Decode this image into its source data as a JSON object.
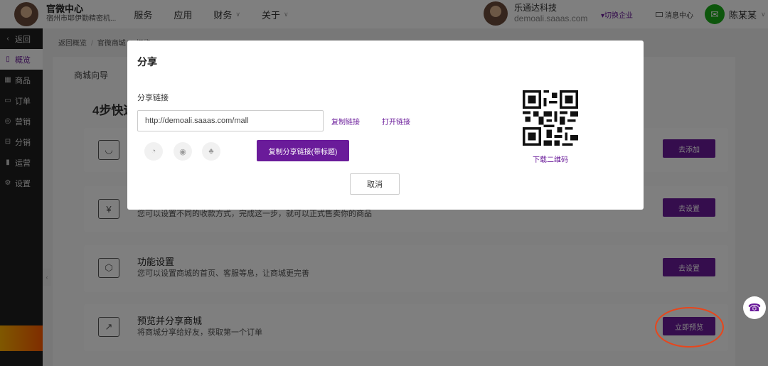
{
  "header": {
    "brand_title": "官微中心",
    "brand_subtitle": "宿州市耶伊勤精密机...",
    "nav": [
      {
        "label": "服务",
        "has_dropdown": false
      },
      {
        "label": "应用",
        "has_dropdown": false
      },
      {
        "label": "财务",
        "has_dropdown": true
      },
      {
        "label": "关于",
        "has_dropdown": true
      }
    ],
    "company_name": "乐通达科技",
    "company_domain": "demoali.saaas.com",
    "switch_company": "▾切换企业",
    "message_center": "消息中心",
    "user_name": "陈某某"
  },
  "sidebar": {
    "items": [
      {
        "label": "返回",
        "icon": "chevron-left-icon",
        "glyph": "‹",
        "active": false
      },
      {
        "label": "概览",
        "icon": "overview-icon",
        "glyph": "▯",
        "active": true
      },
      {
        "label": "商品",
        "icon": "goods-icon",
        "glyph": "▦",
        "active": false
      },
      {
        "label": "订单",
        "icon": "order-icon",
        "glyph": "▭",
        "active": false
      },
      {
        "label": "营销",
        "icon": "marketing-icon",
        "glyph": "◎",
        "active": false
      },
      {
        "label": "分销",
        "icon": "distribution-icon",
        "glyph": "⊟",
        "active": false
      },
      {
        "label": "运营",
        "icon": "operations-icon",
        "glyph": "▮",
        "active": false
      },
      {
        "label": "设置",
        "icon": "settings-icon",
        "glyph": "⚙",
        "active": false
      }
    ]
  },
  "breadcrumb": [
    "返回概览",
    "官微商城",
    "概览"
  ],
  "guide": {
    "section_title": "商城向导",
    "steps_title": "4步快速",
    "cards": [
      {
        "title": "",
        "desc": "",
        "button": "去添加",
        "icon": "bag-icon",
        "glyph": "◡"
      },
      {
        "title": "",
        "desc": "您可以设置不同的收款方式，完成这一步，就可以正式售卖你的商品",
        "button": "去设置",
        "icon": "payment-icon",
        "glyph": "¥"
      },
      {
        "title": "功能设置",
        "desc": "您可以设置商城的首页、客服等息，让商城更完善",
        "button": "去设置",
        "icon": "feature-icon",
        "glyph": "⬡"
      },
      {
        "title": "预览并分享商城",
        "desc": "将商城分享给好友，获取第一个订单",
        "button": "立即预览",
        "icon": "share-arrow-icon",
        "glyph": "↗"
      }
    ]
  },
  "modal": {
    "title": "分享",
    "share_link_label": "分享链接",
    "link_value": "http://demoali.saaas.com/mall",
    "copy_link": "复制链接",
    "open_link": "打开链接",
    "copy_with_title": "复制分享链接(带标题)",
    "cancel": "取消",
    "download_qr": "下载二维码"
  },
  "colors": {
    "accent": "#6a1b9a",
    "highlight_ring": "#e8461c"
  }
}
